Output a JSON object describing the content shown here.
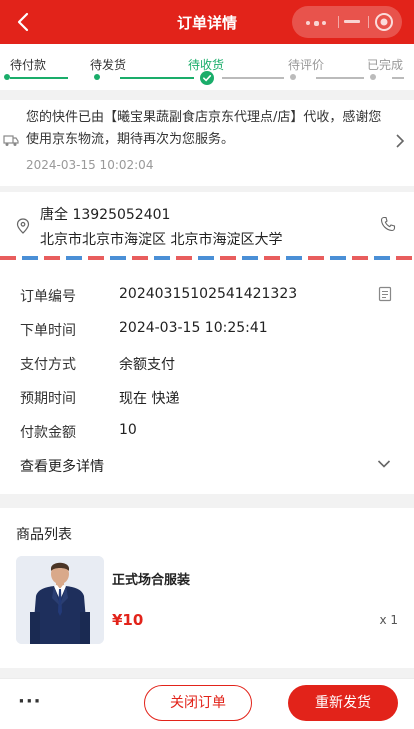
{
  "header": {
    "title": "订单详情"
  },
  "steps": [
    {
      "label": "待付款",
      "state": "done"
    },
    {
      "label": "待发货",
      "state": "done"
    },
    {
      "label": "待收货",
      "state": "current"
    },
    {
      "label": "待评价",
      "state": "todo"
    },
    {
      "label": "已完成",
      "state": "todo"
    }
  ],
  "logistics": {
    "message": "您的快件已由【曦宝果蔬副食店京东代理点/店】代收，感谢您使用京东物流，期待再次为您服务。",
    "time": "2024-03-15 10:02:04"
  },
  "address": {
    "name_phone": "唐全 13925052401",
    "detail": "北京市北京市海淀区 北京市海淀区大学"
  },
  "order_info": {
    "rows": [
      {
        "key": "订单编号",
        "value": "20240315102541421323"
      },
      {
        "key": "下单时间",
        "value": "2024-03-15 10:25:41"
      },
      {
        "key": "支付方式",
        "value": "余额支付"
      },
      {
        "key": "预期时间",
        "value": "现在 快递"
      },
      {
        "key": "付款金额",
        "value": "10"
      }
    ],
    "more_label": "查看更多详情"
  },
  "goods": {
    "title": "商品列表",
    "items": [
      {
        "name": "正式场合服装",
        "price": "¥10",
        "qty": "x 1"
      }
    ]
  },
  "bottom_bar": {
    "more": "···",
    "close_label": "关闭订单",
    "resend_label": "重新发货"
  },
  "colors": {
    "brand": "#e2231a",
    "progress": "#1aad6a"
  }
}
